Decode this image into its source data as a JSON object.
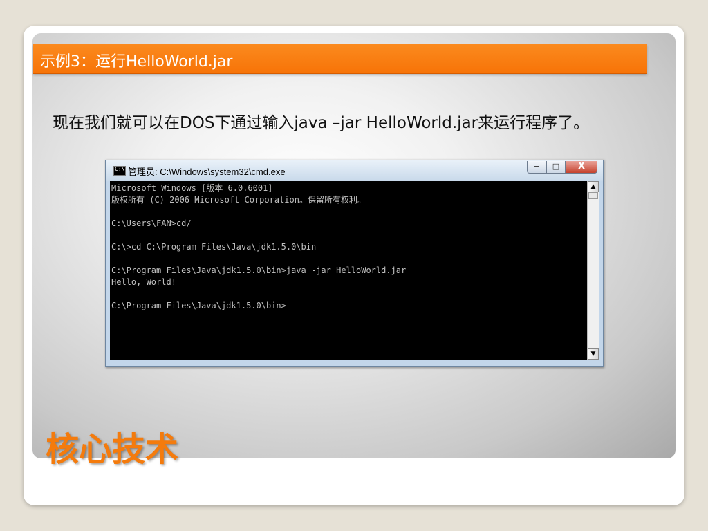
{
  "slide": {
    "title": "示例3：运行HelloWorld.jar",
    "subtitle": "现在我们就可以在DOS下通过输入java –jar HelloWorld.jar来运行程序了。",
    "footer": "核心技术"
  },
  "cmd_window": {
    "title": "管理员: C:\\Windows\\system32\\cmd.exe",
    "controls": {
      "minimize": "−",
      "maximize": "□",
      "close": "X"
    },
    "console_lines": "Microsoft Windows [版本 6.0.6001]\n版权所有 (C) 2006 Microsoft Corporation。保留所有权利。\n\nC:\\Users\\FAN>cd/\n\nC:\\>cd C:\\Program Files\\Java\\jdk1.5.0\\bin\n\nC:\\Program Files\\Java\\jdk1.5.0\\bin>java -jar HelloWorld.jar\nHello, World!\n\nC:\\Program Files\\Java\\jdk1.5.0\\bin>",
    "scroll_up": "▲",
    "scroll_down": "▼"
  },
  "colors": {
    "accent": "#f77408",
    "console_bg": "#000000",
    "console_fg": "#c0c0c0"
  }
}
